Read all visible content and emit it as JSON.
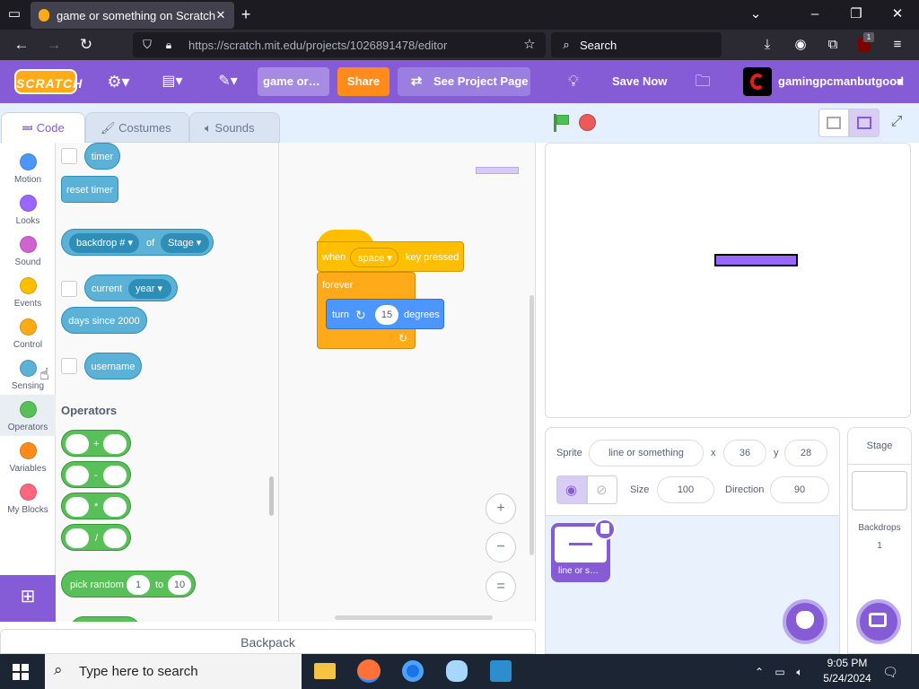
{
  "browser": {
    "tab_title": "game or something on Scratch",
    "url": "https://scratch.mit.edu/projects/1026891478/editor",
    "search_placeholder": "Search",
    "ext_badge": "1"
  },
  "menubar": {
    "logo": "SCRATCH",
    "project_title": "game or…",
    "share": "Share",
    "see_project_page": "See Project Page",
    "save_now": "Save Now",
    "username": "gamingpcmanbutgood",
    "brand_color": "#855cd6"
  },
  "tabs": {
    "code": "Code",
    "costumes": "Costumes",
    "sounds": "Sounds"
  },
  "categories": [
    {
      "label": "Motion",
      "color": "#4c97ff"
    },
    {
      "label": "Looks",
      "color": "#9966ff"
    },
    {
      "label": "Sound",
      "color": "#cf63cf"
    },
    {
      "label": "Events",
      "color": "#ffbf00"
    },
    {
      "label": "Control",
      "color": "#ffab19"
    },
    {
      "label": "Sensing",
      "color": "#5cb1d6"
    },
    {
      "label": "Operators",
      "color": "#59c059"
    },
    {
      "label": "Variables",
      "color": "#ff8c1a"
    },
    {
      "label": "My Blocks",
      "color": "#ff6680"
    }
  ],
  "palette": {
    "timer": "timer",
    "reset_timer": "reset timer",
    "backdrop_num": "backdrop #",
    "of": "of",
    "stage": "Stage",
    "current": "current",
    "year": "year",
    "days_since": "days since 2000",
    "username": "username",
    "operators_heading": "Operators",
    "plus": "+",
    "minus": "-",
    "times": "*",
    "divide": "/",
    "pick_random": "pick random",
    "rand_from": "1",
    "to": "to",
    "rand_to": "10"
  },
  "script": {
    "when": "when",
    "key": "space",
    "key_pressed": "key pressed",
    "forever": "forever",
    "turn": "turn",
    "degrees_value": "15",
    "degrees": "degrees"
  },
  "zoom": {
    "in": "+",
    "out": "−",
    "reset": "="
  },
  "backpack": "Backpack",
  "sprite_info": {
    "sprite_label": "Sprite",
    "sprite_name": "line or something",
    "x_label": "x",
    "x": "36",
    "y_label": "y",
    "y": "28",
    "size_label": "Size",
    "size": "100",
    "direction_label": "Direction",
    "direction": "90"
  },
  "sprite_thumb": "line or s…",
  "stage_pane": {
    "title": "Stage",
    "backdrops_label": "Backdrops",
    "backdrops_count": "1"
  },
  "taskbar": {
    "search": "Type here to search",
    "time": "9:05 PM",
    "date": "5/24/2024"
  }
}
